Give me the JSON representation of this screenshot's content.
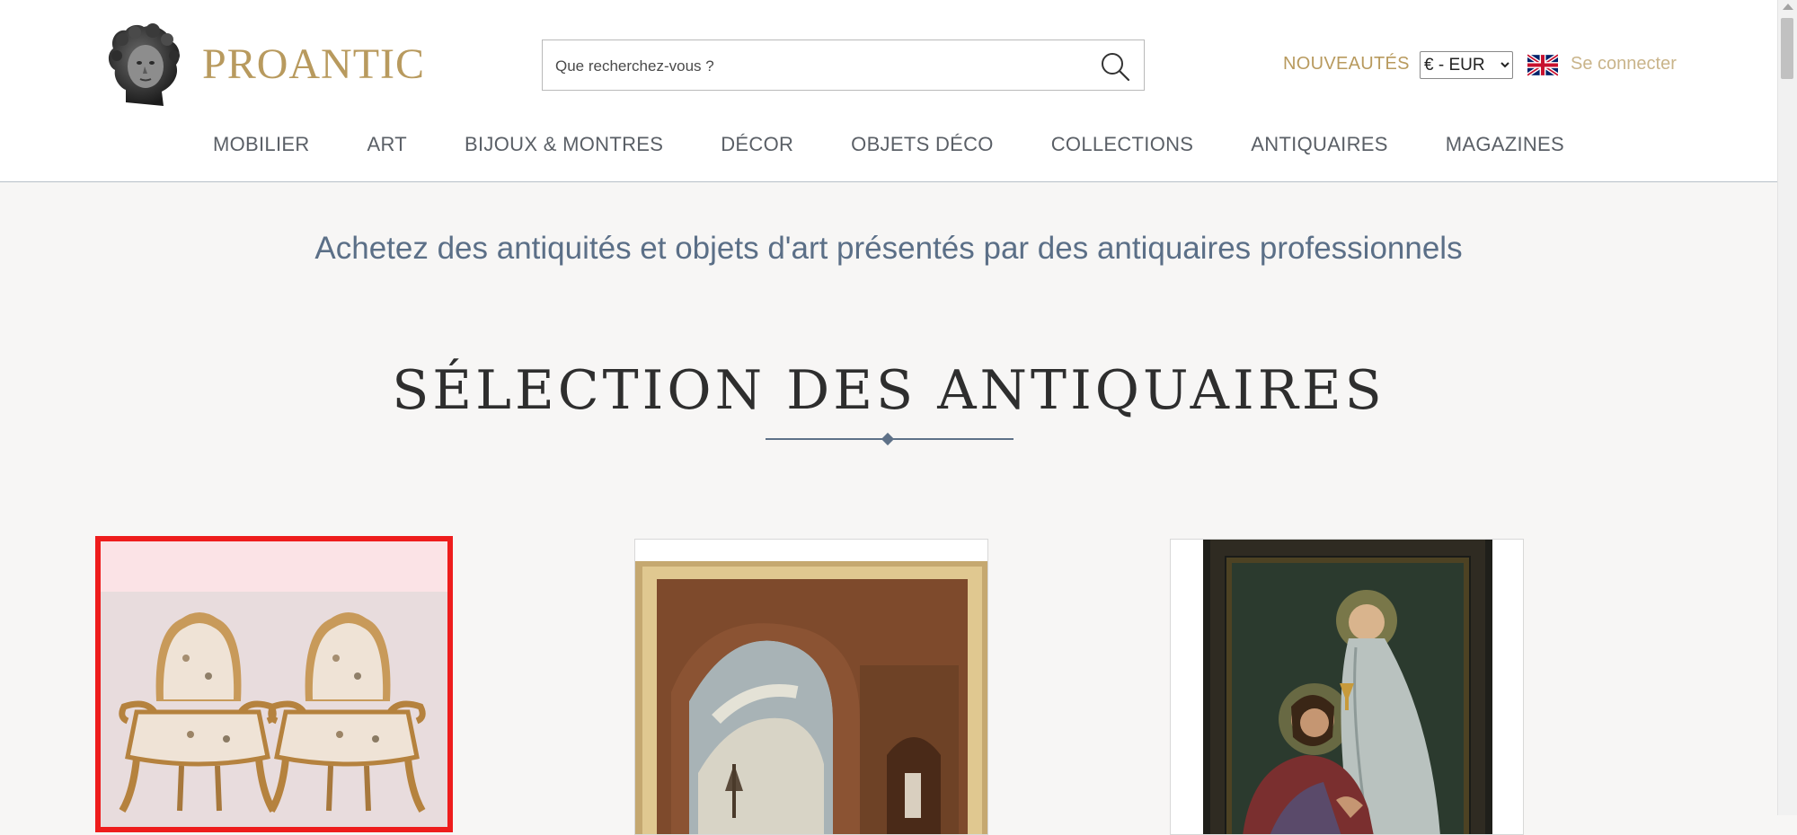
{
  "brand": {
    "name": "PROANTIC"
  },
  "search": {
    "placeholder": "Que recherchez-vous ?"
  },
  "header": {
    "nouveautes": "NOUVEAUTÉS",
    "currency": {
      "selected": "€ - EUR"
    },
    "language_flag": "uk-flag-icon",
    "connect": "Se connecter"
  },
  "nav": [
    {
      "label": "MOBILIER"
    },
    {
      "label": "ART"
    },
    {
      "label": "BIJOUX & MONTRES"
    },
    {
      "label": "DÉCOR"
    },
    {
      "label": "OBJETS DÉCO"
    },
    {
      "label": "COLLECTIONS"
    },
    {
      "label": "ANTIQUAIRES"
    },
    {
      "label": "MAGAZINES"
    }
  ],
  "tagline": "Achetez des antiquités et objets d'art présentés par des antiquaires professionnels",
  "section": {
    "title": "SÉLECTION DES ANTIQUAIRES"
  },
  "cards": [
    {
      "subject": "pair-of-upholstered-armchairs",
      "selected": true
    },
    {
      "subject": "framed-painting-ruins-arch",
      "selected": false
    },
    {
      "subject": "framed-painting-religious-scene",
      "selected": false
    }
  ],
  "colors": {
    "brand_gold": "#b89a5e",
    "nav_text": "#5a5f66",
    "tagline_blue": "#5b6f87",
    "selection_red": "#ee1c1c"
  }
}
